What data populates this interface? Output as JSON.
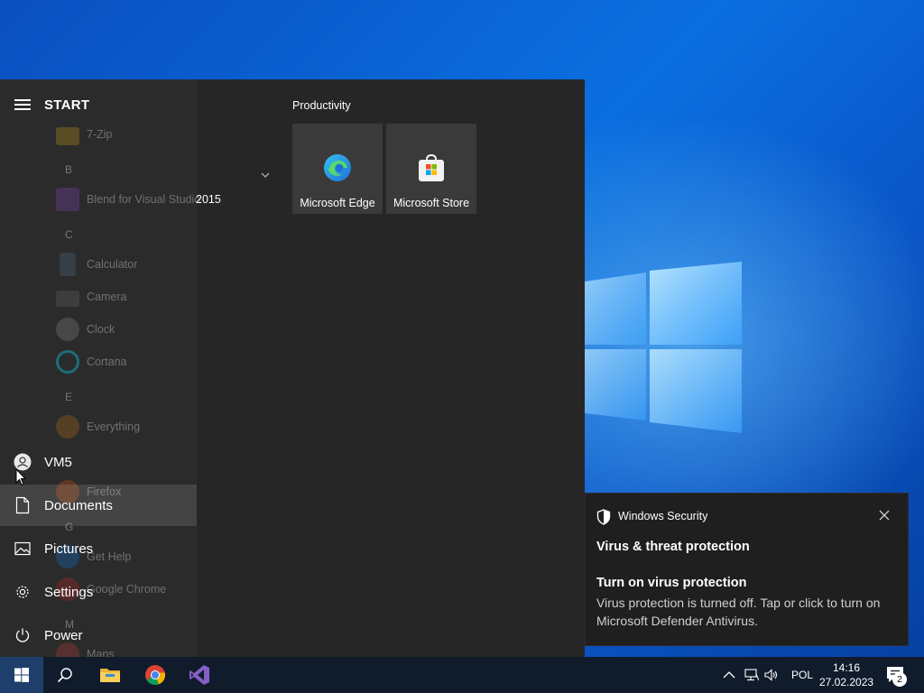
{
  "start_menu": {
    "title": "START",
    "apps": [
      {
        "label": "7-Zip",
        "icon": "folder-icon"
      },
      {
        "letter": "B"
      },
      {
        "label": "Blend for Visual Studio",
        "icon": "blend-icon",
        "overflow": "2015"
      },
      {
        "letter": "C"
      },
      {
        "label": "Calculator",
        "icon": "calculator-icon"
      },
      {
        "label": "Camera",
        "icon": "camera-icon"
      },
      {
        "label": "Clock",
        "icon": "clock-icon"
      },
      {
        "label": "Cortana",
        "icon": "cortana-icon"
      },
      {
        "letter": "E"
      },
      {
        "label": "Everything",
        "icon": "magnifier-icon"
      },
      {
        "label": "Firefox",
        "icon": "firefox-icon"
      },
      {
        "letter": "G"
      },
      {
        "label": "Get Help",
        "icon": "help-icon"
      },
      {
        "label": "Google Chrome",
        "icon": "chrome-icon"
      },
      {
        "letter": "M"
      },
      {
        "label": "Maps",
        "icon": "maps-icon"
      }
    ],
    "rail": {
      "user": "VM5",
      "documents": "Documents",
      "pictures": "Pictures",
      "settings": "Settings",
      "power": "Power"
    },
    "group_title": "Productivity",
    "tiles": [
      {
        "label": "Microsoft Edge",
        "icon": "edge-icon"
      },
      {
        "label": "Microsoft Store",
        "icon": "store-icon"
      }
    ]
  },
  "notification": {
    "app_name": "Windows Security",
    "heading": "Virus & threat protection",
    "title": "Turn on virus protection",
    "body": "Virus protection is turned off. Tap or click to turn on Microsoft Defender Antivirus."
  },
  "taskbar": {
    "language": "POL",
    "time": "14:16",
    "date": "27.02.2023",
    "notification_count": "2"
  },
  "colors": {
    "start_bg": "#262626",
    "rail_bg": "#2b2b2b",
    "tile_bg": "#3a3a3a",
    "taskbar_bg": "#101b2c",
    "accent": "#0a5cc9"
  }
}
